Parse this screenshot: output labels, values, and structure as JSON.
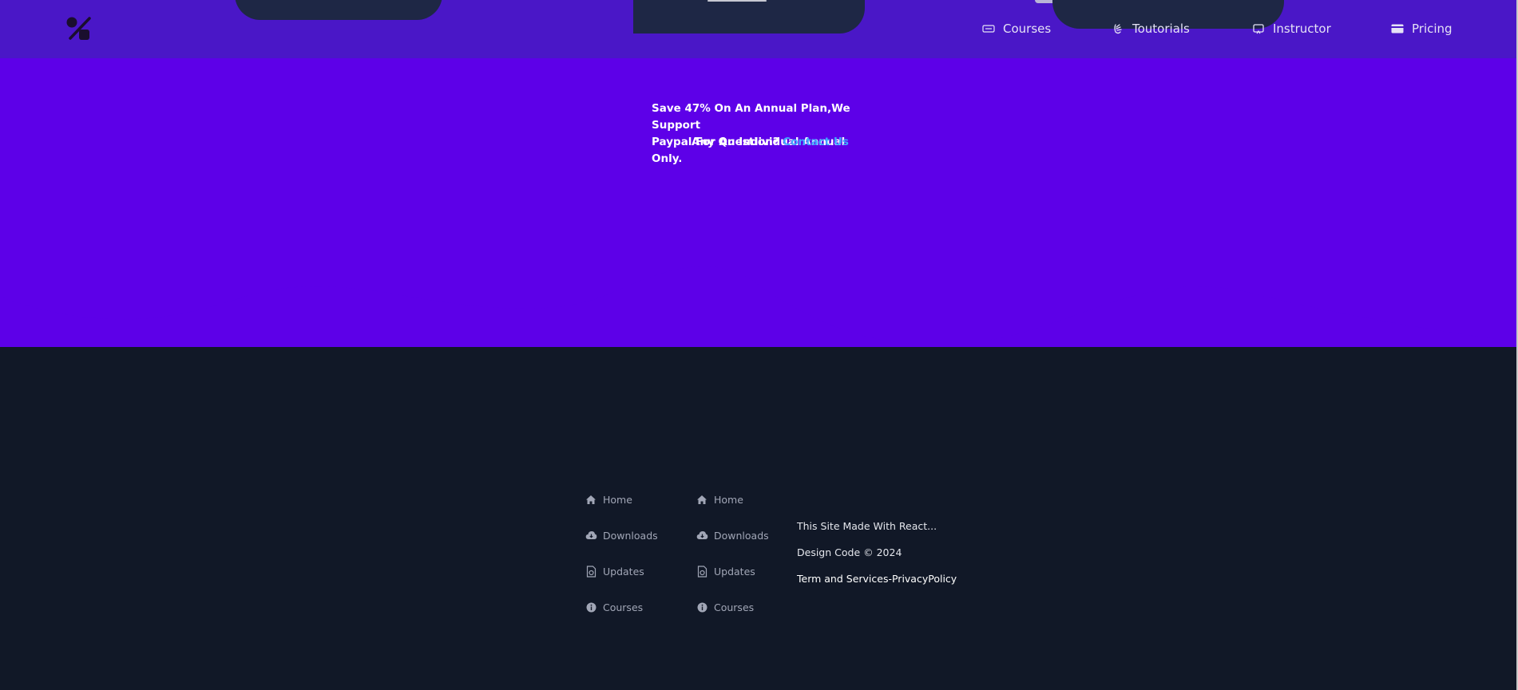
{
  "nav": {
    "items": [
      {
        "label": "Courses",
        "icon": "keyboard-icon"
      },
      {
        "label": "Toutorials",
        "icon": "hand-wave-icon"
      },
      {
        "label": "Instructor",
        "icon": "monitor-icon"
      },
      {
        "label": "Pricing",
        "icon": "credit-card-icon"
      }
    ]
  },
  "promo": {
    "line1": "Save 47% On An Annual Plan,We Support",
    "line2": "Paypal For An Individual Annual Only.",
    "question": "Any Question?",
    "contact_label": "Contact Us"
  },
  "footer": {
    "column1": [
      {
        "label": "Home",
        "icon": "home-icon"
      },
      {
        "label": "Downloads",
        "icon": "cloud-download-icon"
      },
      {
        "label": "Updates",
        "icon": "file-update-icon"
      },
      {
        "label": "Courses",
        "icon": "info-icon"
      }
    ],
    "column2": [
      {
        "label": "Home",
        "icon": "home-icon"
      },
      {
        "label": "Downloads",
        "icon": "cloud-download-icon"
      },
      {
        "label": "Updates",
        "icon": "file-update-icon"
      },
      {
        "label": "Courses",
        "icon": "info-icon"
      }
    ],
    "made_with": "This Site Made With React...",
    "copyright": "Design Code © 2024",
    "terms": "Term and Services-PrivacyPolicy"
  },
  "colors": {
    "header_bg": "#4a17c7",
    "promo_bg": "#5d00e8",
    "footer_bg": "#111827",
    "link_accent": "#3fa8ff"
  }
}
